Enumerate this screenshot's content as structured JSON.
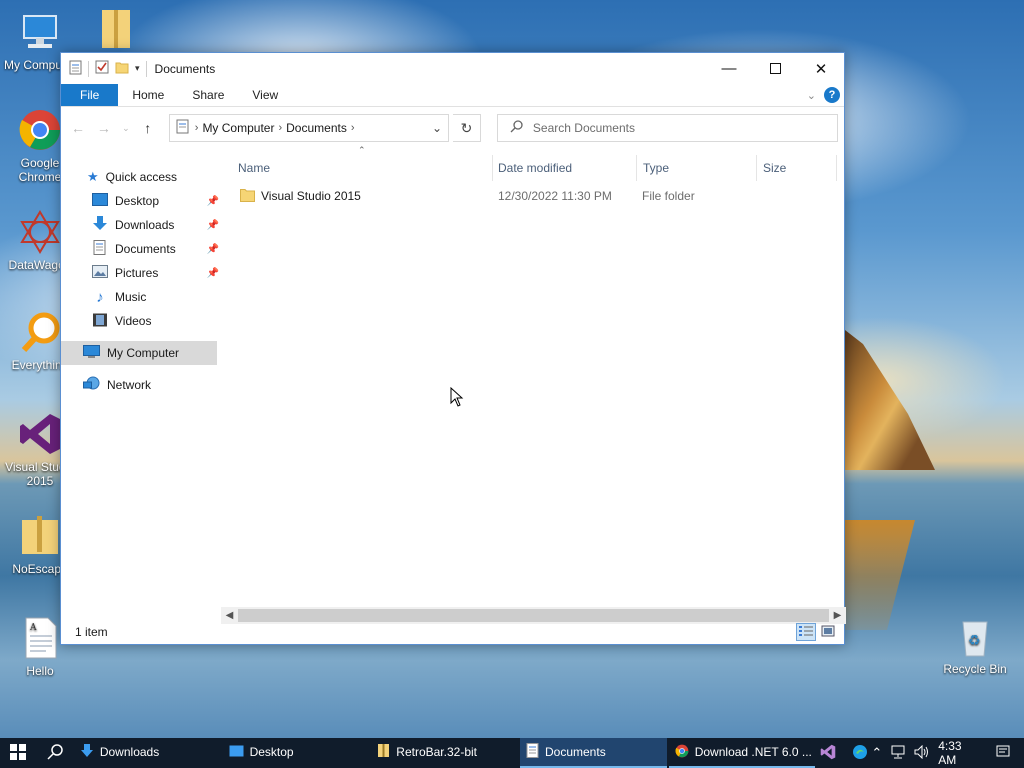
{
  "desktop": {
    "icons": [
      {
        "label": "My Computer"
      },
      {
        "label": "Google Chrome"
      },
      {
        "label": "DataWagon"
      },
      {
        "label": "Everything"
      },
      {
        "label": "Visual Studio 2015"
      },
      {
        "label": "NoEscape"
      },
      {
        "label": "Hello"
      },
      {
        "label": "Recycle Bin"
      }
    ]
  },
  "window": {
    "title": "Documents",
    "ribbon": {
      "tabs": [
        "File",
        "Home",
        "Share",
        "View"
      ]
    },
    "address": {
      "crumbs": [
        "My Computer",
        "Documents"
      ]
    },
    "search": {
      "placeholder": "Search Documents"
    },
    "nav": {
      "quick_access": "Quick access",
      "items": [
        "Desktop",
        "Downloads",
        "Documents",
        "Pictures",
        "Music",
        "Videos"
      ],
      "this_pc": "My Computer",
      "network": "Network"
    },
    "columns": [
      "Name",
      "Date modified",
      "Type",
      "Size"
    ],
    "files": [
      {
        "name": "Visual Studio 2015",
        "date": "12/30/2022 11:30 PM",
        "type": "File folder",
        "size": ""
      }
    ],
    "status": "1 item"
  },
  "taskbar": {
    "apps": [
      {
        "label": "Downloads",
        "icon": "download-arrow-icon"
      },
      {
        "label": "Desktop",
        "icon": "desktop-icon"
      },
      {
        "label": "RetroBar.32-bit",
        "icon": "zip-folder-icon"
      },
      {
        "label": "Documents",
        "icon": "documents-icon"
      },
      {
        "label": "Download .NET 6.0 ...",
        "icon": "chrome-icon"
      }
    ],
    "clock": "4:33 AM"
  },
  "colors": {
    "accent": "#1979ca",
    "taskbar": "#101c2b",
    "selection": "#d9d9d9"
  }
}
